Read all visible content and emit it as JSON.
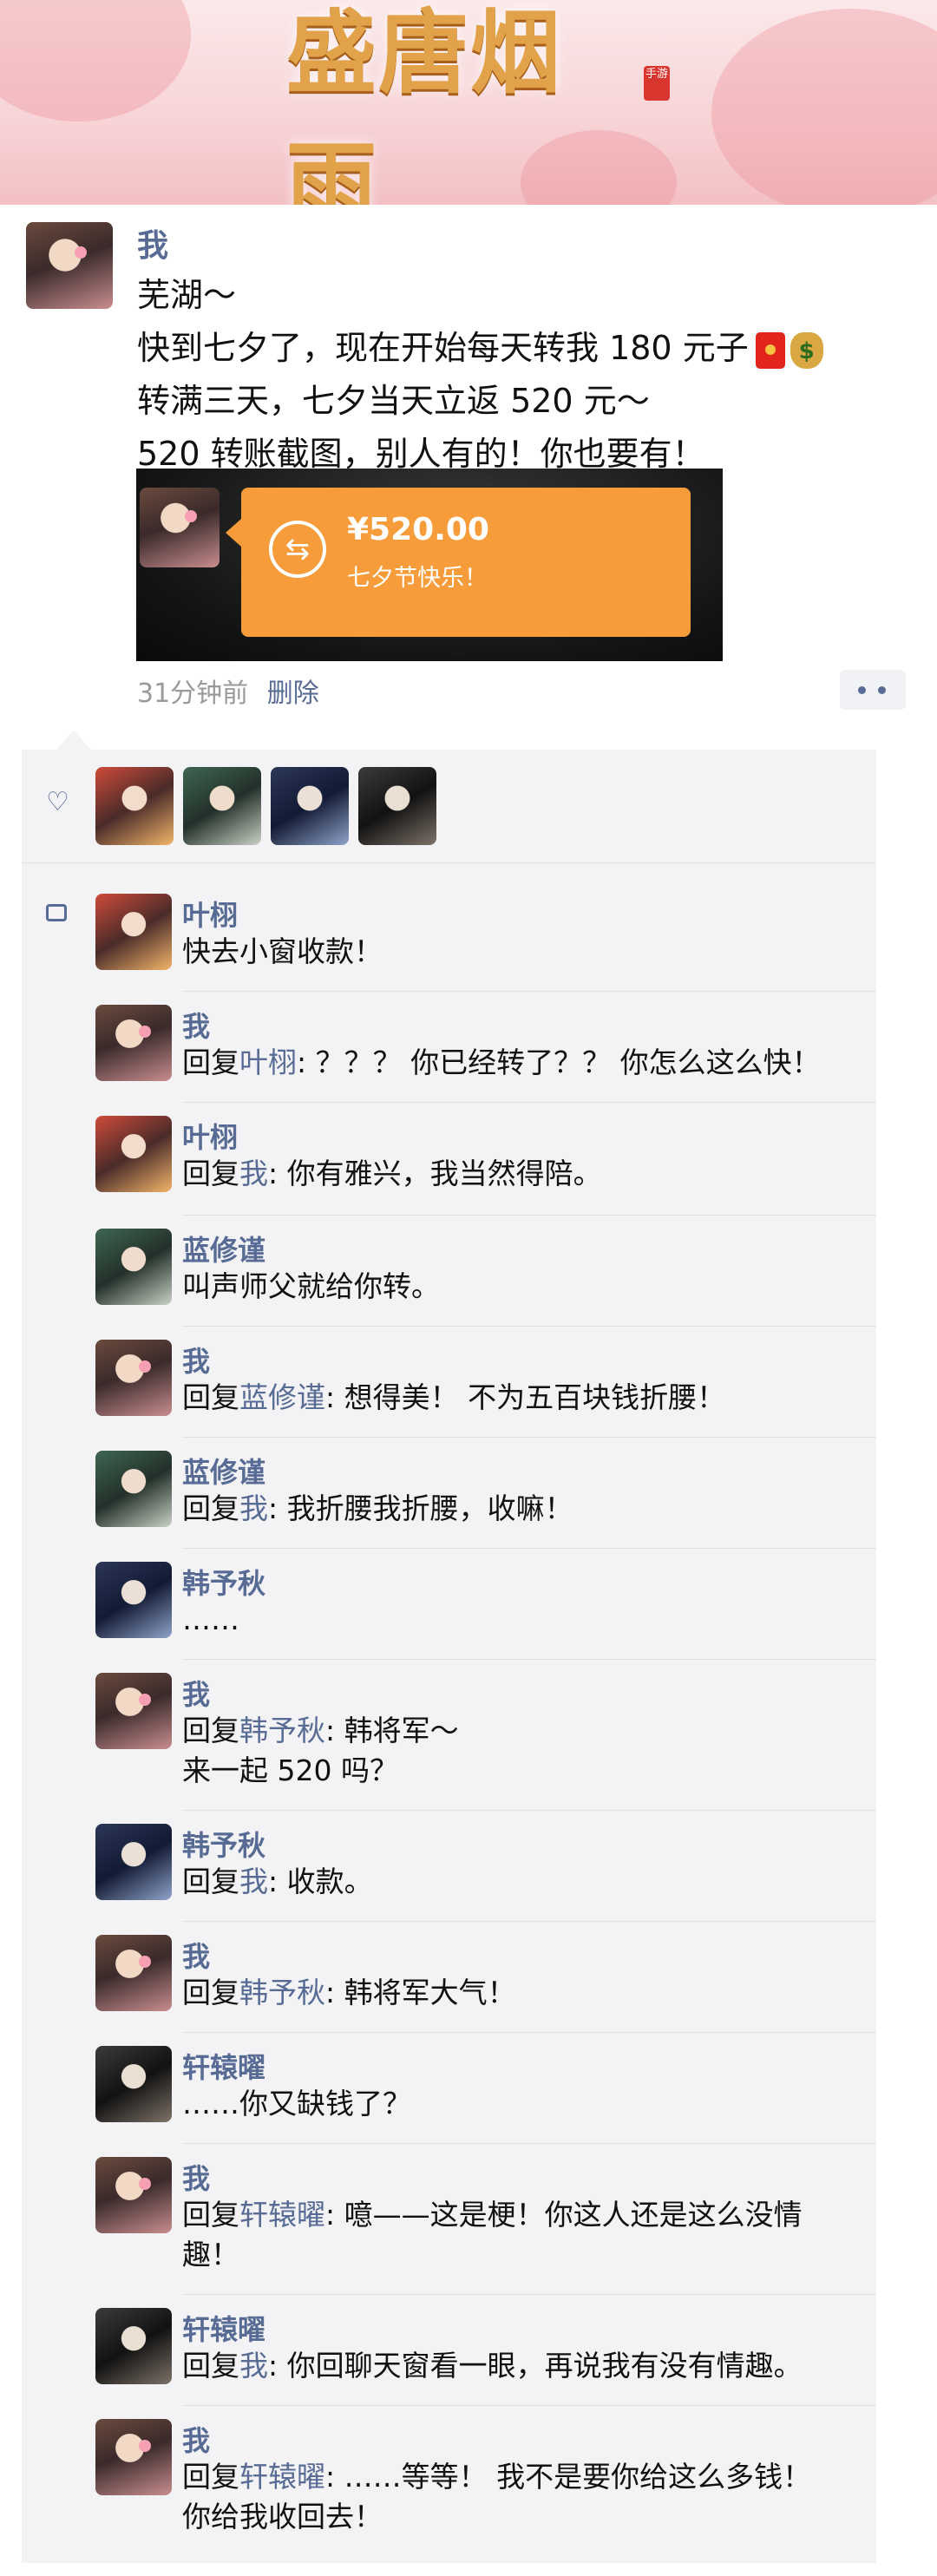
{
  "banner": {
    "logo_text": "盛唐烟雨",
    "logo_tag": "手游"
  },
  "post": {
    "author": "我",
    "lines": [
      "芜湖～",
      "快到七夕了，现在开始每天转我 180 元子",
      "转满三天，七夕当天立返 520 元～",
      "520 转账截图，别人有的！你也要有！"
    ],
    "transfer": {
      "amount": "¥520.00",
      "note": "七夕节快乐！",
      "icon": "transfer-arrows-icon"
    },
    "time": "31分钟前",
    "delete_label": "删除"
  },
  "likes": {
    "icon": "heart-icon",
    "count_avatars": 4
  },
  "reply_word": "回复",
  "comments": [
    {
      "name": "叶栩",
      "text": "快去小窗收款！"
    },
    {
      "name": "我",
      "target": "叶栩",
      "text": ": ？？？ 你已经转了？？ 你怎么这么快！"
    },
    {
      "name": "叶栩",
      "target": "我",
      "text": ": 你有雅兴，我当然得陪。"
    },
    {
      "name": "蓝修谨",
      "text": "叫声师父就给你转。"
    },
    {
      "name": "我",
      "target": "蓝修谨",
      "text": ": 想得美！ 不为五百块钱折腰！"
    },
    {
      "name": "蓝修谨",
      "target": "我",
      "text": ": 我折腰我折腰，收嘛！"
    },
    {
      "name": "韩予秋",
      "text": "……"
    },
    {
      "name": "我",
      "target": "韩予秋",
      "text": ": 韩将军～",
      "text2": "来一起 520 吗？"
    },
    {
      "name": "韩予秋",
      "target": "我",
      "text": ": 收款。"
    },
    {
      "name": "我",
      "target": "韩予秋",
      "text": ": 韩将军大气！"
    },
    {
      "name": "轩辕曜",
      "text": "……你又缺钱了？"
    },
    {
      "name": "我",
      "target": "轩辕曜",
      "text": ": 噫——这是梗！你这人还是这么没情",
      "text2": "趣！"
    },
    {
      "name": "轩辕曜",
      "target": "我",
      "text": ": 你回聊天窗看一眼，再说我有没有情趣。"
    },
    {
      "name": "我",
      "target": "轩辕曜",
      "text": ": ……等等！ 我不是要你给这么多钱！",
      "text2": "你给我收回去！"
    }
  ],
  "colors": {
    "link": "#576b95",
    "transfer": "#f79c3b",
    "panel": "#f3f3f5"
  }
}
